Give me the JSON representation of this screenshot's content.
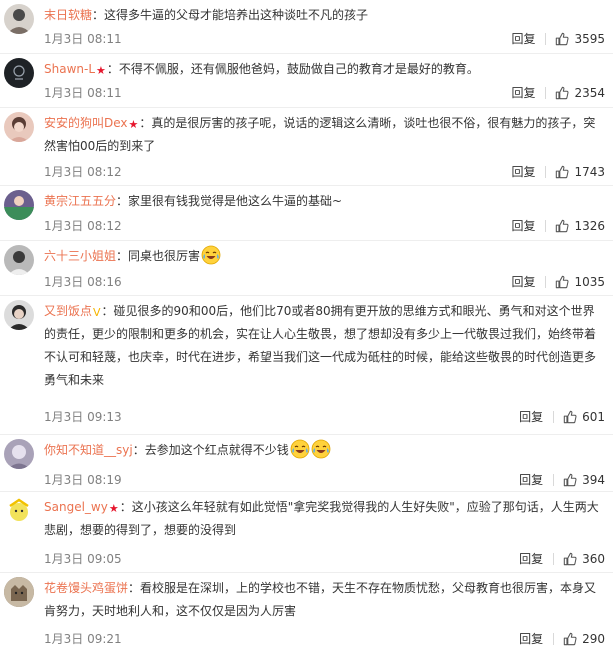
{
  "reply_label": "回复",
  "comments": [
    {
      "user": "末日软糖",
      "badge": "",
      "text": "：这得多牛逼的父母才能培养出这种谈吐不凡的孩子",
      "emoji_count": 0,
      "time": "1月3日 08:11",
      "likes": "3595",
      "avatar_color": "#d7d2cc"
    },
    {
      "user": "Shawn-L",
      "badge": "red",
      "text": "：不得不佩服，还有佩服他爸妈，鼓励做自己的教育才是最好的教育。",
      "emoji_count": 0,
      "time": "1月3日 08:11",
      "likes": "2354",
      "avatar_color": "#1e2226"
    },
    {
      "user": "安安的狗叫Dex",
      "badge": "red",
      "text": "：真的是很厉害的孩子呢，说话的逻辑这么清晰，谈吐也很不俗，很有魅力的孩子，突然害怕00后的到来了",
      "emoji_count": 0,
      "time": "1月3日 08:12",
      "likes": "1743",
      "avatar_color": "#e9c9bd"
    },
    {
      "user": "黄宗江五五分",
      "badge": "",
      "text": "：家里很有钱我觉得是他这么牛逼的基础~",
      "emoji_count": 0,
      "time": "1月3日 08:12",
      "likes": "1326",
      "avatar_color": "#6b5f8e"
    },
    {
      "user": "六十三小姐姐",
      "badge": "",
      "text": "：同桌也很厉害",
      "emoji_count": 1,
      "time": "1月3日 08:16",
      "likes": "1035",
      "avatar_color": "#b9b9b9"
    },
    {
      "user": "又到饭点",
      "badge": "gold",
      "text": "：碰见很多的90和00后，他们比70或者80拥有更开放的思维方式和眼光、勇气和对这个世界的责任，更少的限制和更多的机会，实在让人心生敬畏，想了想却没有多少上一代敬畏过我们，始终带着不认可和轻蔑，也庆幸，时代在进步，希望当我们这一代成为砥柱的时候，能给这些敬畏的时代创造更多勇气和未来",
      "emoji_count": 0,
      "time": "1月3日 09:13",
      "likes": "601",
      "avatar_color": "#3a3a3a"
    },
    {
      "user": "你知不知道__syj",
      "badge": "",
      "text": "：去参加这个红点就得不少钱",
      "emoji_count": 2,
      "time": "1月3日 08:19",
      "likes": "394",
      "avatar_color": "#a9a2b8"
    },
    {
      "user": "Sangel_wy",
      "badge": "red",
      "text": "：这小孩这么年轻就有如此觉悟\"拿完奖我觉得我的人生好失败\"，应验了那句话，人生两大悲剧，想要的得到了，想要的没得到",
      "emoji_count": 0,
      "time": "1月3日 09:05",
      "likes": "360",
      "avatar_color": "#f2e25a"
    },
    {
      "user": "花卷馒头鸡蛋饼",
      "badge": "",
      "text": "：看校服是在深圳，上的学校也不错，天生不存在物质忧愁，父母教育也很厉害，本身又肯努力，天时地利人和，这不仅仅是因为人厉害",
      "emoji_count": 0,
      "time": "1月3日 09:21",
      "likes": "290",
      "avatar_color": "#8a7e70"
    }
  ]
}
